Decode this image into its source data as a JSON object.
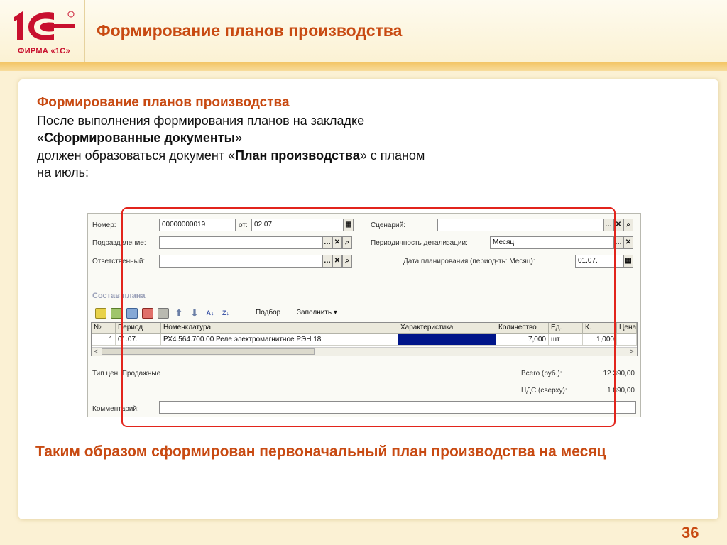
{
  "header": {
    "title": "Формирование планов производства",
    "logo_text": "1С",
    "logo_caption": "ФИРМА «1С»"
  },
  "intro": {
    "heading": "Формирование планов производства",
    "line1": "После выполнения формирования планов на закладке",
    "quote_open": "«",
    "tab_name": "Сформированные документы",
    "quote_close": "»",
    "line3_prefix": "должен образоваться документ «",
    "doc_name": "План производства",
    "line3_suffix": "» с планом",
    "line4": "на июль:"
  },
  "form": {
    "number_label": "Номер:",
    "number_value": "00000000019",
    "from_label": "от:",
    "date_value": "02.07.",
    "scenario_label": "Сценарий:",
    "scenario_value": "",
    "division_label": "Подразделение:",
    "division_value": "",
    "periodicity_label": "Периодичность детализации:",
    "periodicity_value": "Месяц",
    "responsible_label": "Ответственный:",
    "responsible_value": "",
    "plan_date_label": "Дата планирования (период-ть: Месяц):",
    "plan_date_value": "01.07.",
    "section_title": "Состав плана",
    "toolbar": {
      "pick_label": "Подбор",
      "fill_label": "Заполнить ▾"
    },
    "table": {
      "columns": [
        "№",
        "Период",
        "Номенклатура",
        "Характеристика",
        "Количество",
        "Ед.",
        "К.",
        "Цена"
      ],
      "rows": [
        {
          "num": "1",
          "period": "01.07.",
          "item": "РХ4.564.700.00 Реле электромагнитное РЭН 18",
          "characteristic": "",
          "quantity": "7,000",
          "unit": "шт",
          "k": "1,000",
          "price": ""
        }
      ]
    },
    "price_type_label": "Тип цен: Продажные",
    "total_label": "Всего (руб.):",
    "total_value": "12 390,00",
    "vat_label": "НДС (сверху):",
    "vat_value": "1 890,00",
    "comment_label": "Комментарий:",
    "comment_value": ""
  },
  "conclusion": "Таким образом сформирован первоначальный план производства на месяц",
  "page_number": "36",
  "colors": {
    "accent": "#c84a12",
    "highlight_frame": "#e2241c",
    "logo_red": "#c8102e",
    "selected_cell": "#00158a"
  }
}
